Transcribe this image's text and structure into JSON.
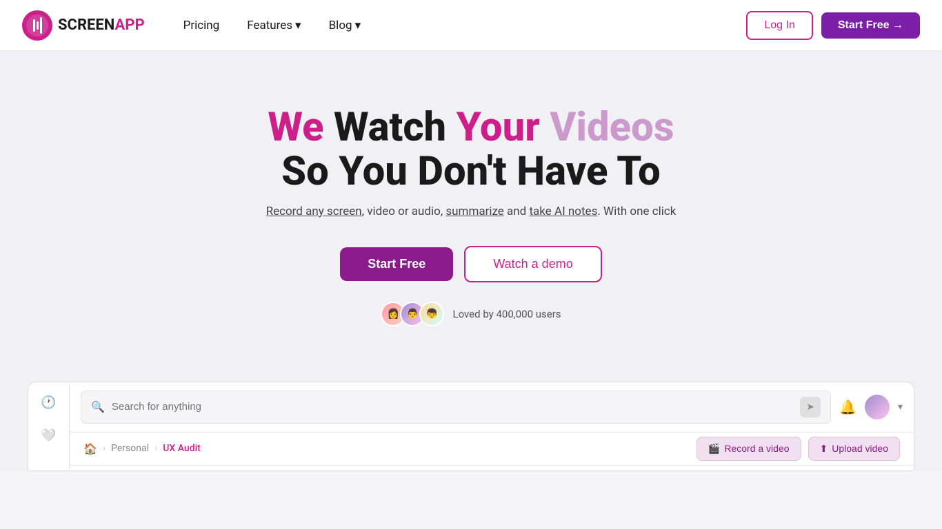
{
  "nav": {
    "logo_screen": "SCREEN",
    "logo_app": "APP",
    "links": [
      {
        "label": "Pricing",
        "has_dropdown": false
      },
      {
        "label": "Features",
        "has_dropdown": true
      },
      {
        "label": "Blog",
        "has_dropdown": true
      }
    ],
    "login_label": "Log In",
    "start_free_label": "Start Free →"
  },
  "hero": {
    "title_line1_we": "We",
    "title_line1_watch": " Watch ",
    "title_line1_your": "Your ",
    "title_line1_videos": "Videos",
    "title_line2": "So You Don't Have To",
    "subtitle_part1": "Record any screen",
    "subtitle_middle": ", video or audio, ",
    "subtitle_summarize": "summarize",
    "subtitle_and": " and ",
    "subtitle_notes": "take AI notes",
    "subtitle_end": ". With one click",
    "start_free_label": "Start Free",
    "watch_demo_label": "Watch a demo",
    "social_proof_text": "Loved by 400,000 users"
  },
  "demo": {
    "search_placeholder": "Search for anything",
    "breadcrumb_home": "🏠",
    "breadcrumb_personal": "Personal",
    "breadcrumb_current": "UX Audit",
    "record_label": "Record a video",
    "upload_label": "Upload video"
  }
}
